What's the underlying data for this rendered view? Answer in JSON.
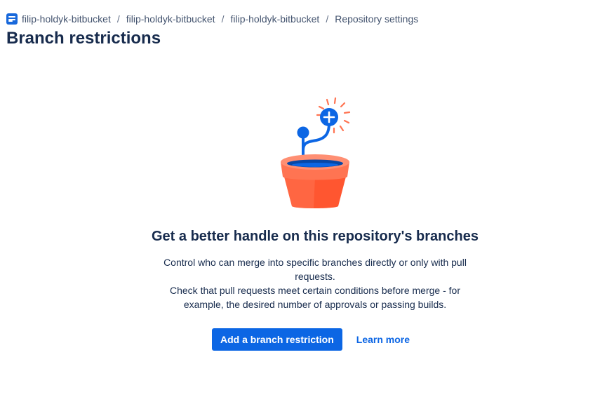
{
  "breadcrumb": {
    "items": [
      {
        "label": "filip-holdyk-bitbucket",
        "icon": "workspace-logo-icon"
      },
      {
        "label": "filip-holdyk-bitbucket"
      },
      {
        "label": "filip-holdyk-bitbucket"
      },
      {
        "label": "Repository settings"
      }
    ],
    "separator": "/"
  },
  "page": {
    "title": "Branch restrictions"
  },
  "empty_state": {
    "illustration": "plant-pot-branch-icon",
    "heading": "Get a better handle on this repository's branches",
    "description_line1": "Control who can merge into specific branches directly or only with pull requests.",
    "description_line2": "Check that pull requests meet certain conditions before merge - for example, the desired number of approvals or passing builds.",
    "primary_action": "Add a branch restriction",
    "secondary_action": "Learn more"
  },
  "colors": {
    "primary": "#0c66e4",
    "heading": "#172b4d",
    "breadcrumb": "#44546f",
    "pot": "#ff5630",
    "sparks": "#ff7452"
  }
}
